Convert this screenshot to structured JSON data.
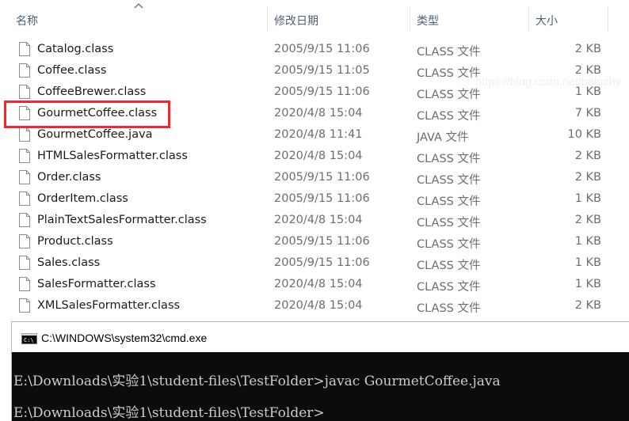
{
  "columns": {
    "name": "名称",
    "date": "修改日期",
    "type": "类型",
    "size": "大小"
  },
  "files": [
    {
      "name": "Catalog.class",
      "date": "2005/9/15 11:06",
      "type": "CLASS 文件",
      "size": "2 KB"
    },
    {
      "name": "Coffee.class",
      "date": "2005/9/15 11:05",
      "type": "CLASS 文件",
      "size": "2 KB"
    },
    {
      "name": "CoffeeBrewer.class",
      "date": "2005/9/15 11:06",
      "type": "CLASS 文件",
      "size": "1 KB"
    },
    {
      "name": "GourmetCoffee.class",
      "date": "2020/4/8 15:04",
      "type": "CLASS 文件",
      "size": "7 KB"
    },
    {
      "name": "GourmetCoffee.java",
      "date": "2020/4/8 11:41",
      "type": "JAVA 文件",
      "size": "10 KB"
    },
    {
      "name": "HTMLSalesFormatter.class",
      "date": "2020/4/8 15:04",
      "type": "CLASS 文件",
      "size": "2 KB"
    },
    {
      "name": "Order.class",
      "date": "2005/9/15 11:06",
      "type": "CLASS 文件",
      "size": "2 KB"
    },
    {
      "name": "OrderItem.class",
      "date": "2005/9/15 11:06",
      "type": "CLASS 文件",
      "size": "1 KB"
    },
    {
      "name": "PlainTextSalesFormatter.class",
      "date": "2020/4/8 15:04",
      "type": "CLASS 文件",
      "size": "2 KB"
    },
    {
      "name": "Product.class",
      "date": "2005/9/15 11:06",
      "type": "CLASS 文件",
      "size": "1 KB"
    },
    {
      "name": "Sales.class",
      "date": "2005/9/15 11:06",
      "type": "CLASS 文件",
      "size": "1 KB"
    },
    {
      "name": "SalesFormatter.class",
      "date": "2020/4/8 15:04",
      "type": "CLASS 文件",
      "size": "1 KB"
    },
    {
      "name": "XMLSalesFormatter.class",
      "date": "2020/4/8 15:04",
      "type": "CLASS 文件",
      "size": "2 KB"
    }
  ],
  "cmd": {
    "title": "C:\\WINDOWS\\system32\\cmd.exe",
    "line1": "E:\\Downloads\\实验1\\student-files\\TestFolder>javac GourmetCoffee.java",
    "line2": "E:\\Downloads\\实验1\\student-files\\TestFolder>"
  },
  "watermark": "https://blog.csdn.net/halozhy",
  "colors": {
    "highlight": "#ff2222",
    "header_text": "#4c607a",
    "console_bg": "#0c0c0c",
    "console_text": "#cccccc"
  }
}
